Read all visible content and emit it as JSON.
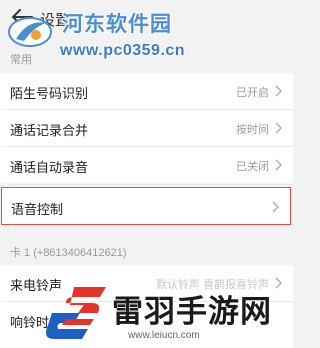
{
  "header": {
    "title": "设置"
  },
  "watermark_top": {
    "site_name": "河东软件园",
    "url": "www.pc0359.cn"
  },
  "section_general": "常用",
  "rows": [
    {
      "label": "陌生号码识别",
      "value": "已开启"
    },
    {
      "label": "通话记录合并",
      "value": "按时间"
    },
    {
      "label": "通话自动录音",
      "value": "已关闭"
    },
    {
      "label": "语音控制",
      "value": ""
    }
  ],
  "sim_section": "卡 1 (+8613406412621)",
  "sim_rows": [
    {
      "label": "来电铃声",
      "value": "默认铃声 喜鹊报喜铃声"
    },
    {
      "label": "响铃时",
      "value": ""
    }
  ],
  "watermark_bottom": {
    "site_name": "雷羽手游网",
    "url": "www.leiucn.com"
  },
  "colors": {
    "highlight": "#e24b4b",
    "watermark_blue": "#4a8ed2",
    "logo_red": "#e63329",
    "logo_blue": "#1e5fc4"
  }
}
